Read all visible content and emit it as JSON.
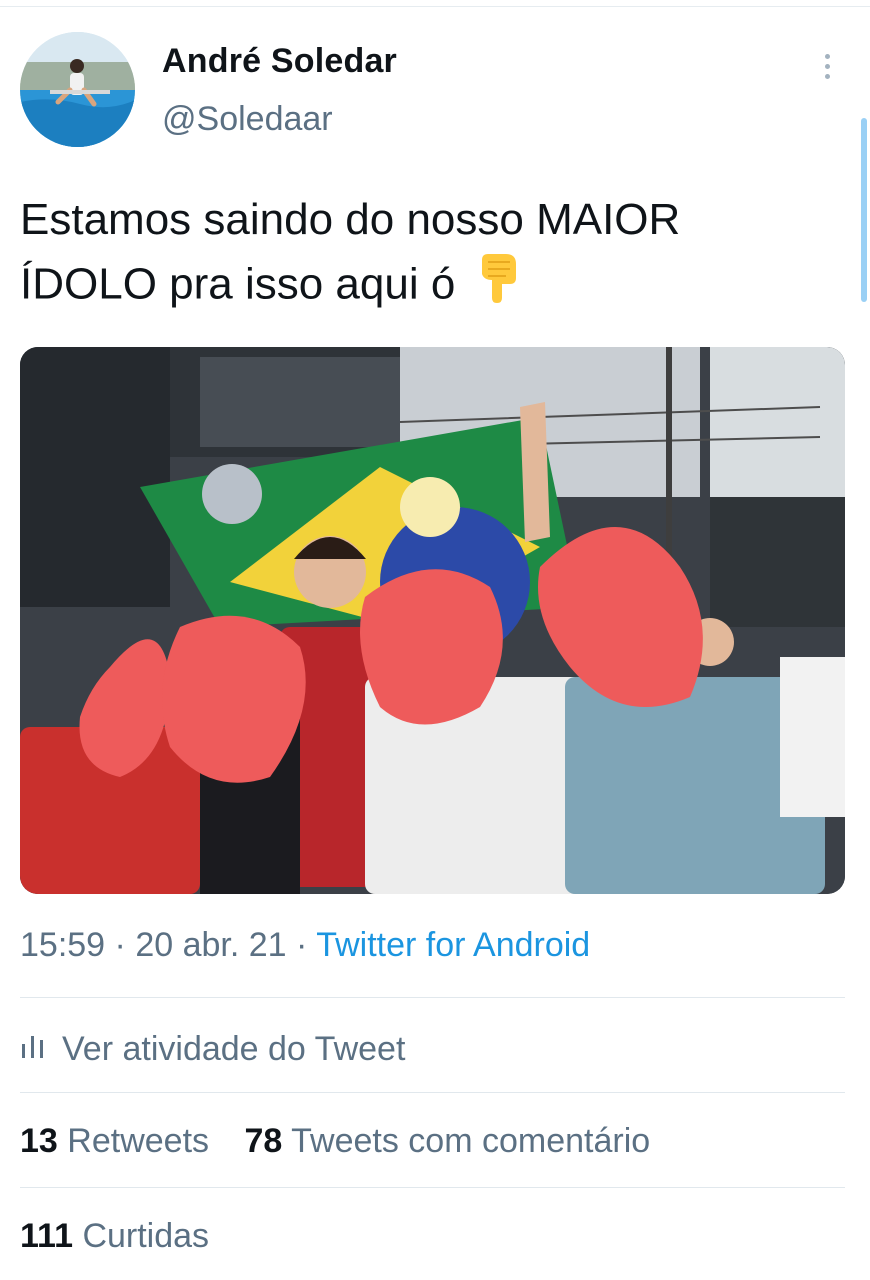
{
  "author": {
    "display_name": "André Soledar",
    "handle": "@Soledaar",
    "avatar_icon": "profile-photo-pool"
  },
  "more_icon": "more-vertical-icon",
  "tweet": {
    "text_line1": "Estamos saindo do nosso MAIOR",
    "text_line2": "ÍDOLO pra isso aqui ó",
    "emoji": "backhand-index-pointing-down"
  },
  "media": {
    "kind": "photo",
    "description_icon": "photo-crowd-with-brazil-flag"
  },
  "meta": {
    "time": "15:59",
    "separator": "·",
    "date": "20 abr. 21",
    "source": "Twitter for Android"
  },
  "activity": {
    "icon": "bar-chart-icon",
    "label": "Ver atividade do Tweet"
  },
  "stats": {
    "retweets_count": "13",
    "retweets_label": "Retweets",
    "quotes_count": "78",
    "quotes_label": "Tweets com comentário",
    "likes_count": "111",
    "likes_label": "Curtidas"
  },
  "colors": {
    "text_primary": "#0f1419",
    "text_secondary": "#5b7083",
    "link": "#1b95e0",
    "divider": "#e1e8ed",
    "redaction": "#ee5b5b"
  }
}
